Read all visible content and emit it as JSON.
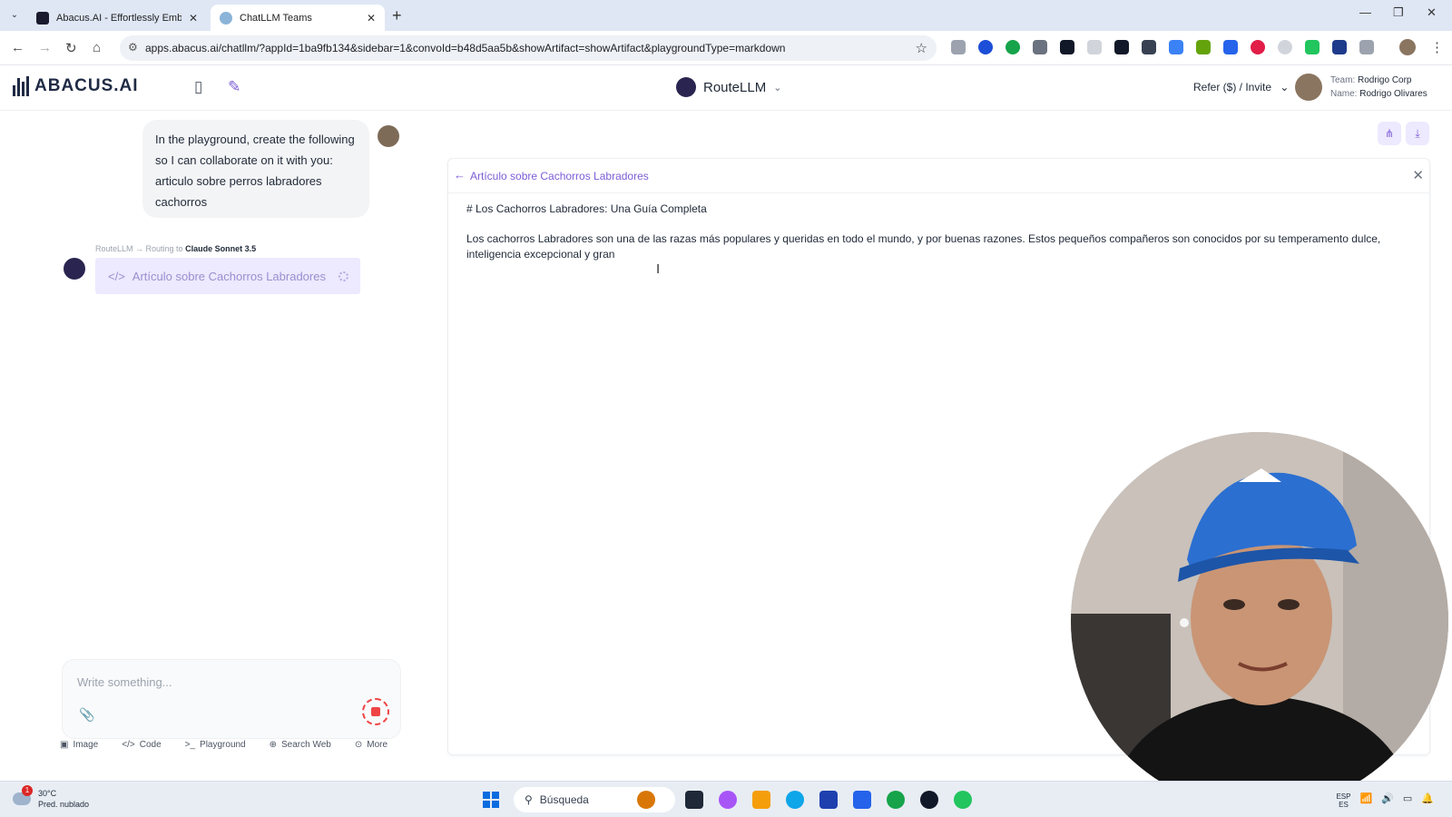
{
  "browser": {
    "tabs": [
      {
        "title": "Abacus.AI - Effortlessly Embed"
      },
      {
        "title": "ChatLLM Teams"
      }
    ],
    "url": "apps.abacus.ai/chatllm/?appId=1ba9fb134&sidebar=1&convoId=b48d5aa5b&showArtifact=showArtifact&playgroundType=markdown"
  },
  "app": {
    "logo": "ABACUS.AI",
    "model": "RouteLLM",
    "refer": "Refer ($) / Invite",
    "team_label": "Team:",
    "team": "Rodrigo Corp",
    "name_label": "Name:",
    "name": "Rodrigo Olivares"
  },
  "chat": {
    "user_message": "In the playground, create the following so I can collaborate on it with you: articulo sobre perros labradores cachorros",
    "routing_prefix": "RouteLLM → Routing to",
    "routing_model": "Claude Sonnet 3.5",
    "artifact_chip": "Artículo sobre Cachorros Labradores"
  },
  "composer": {
    "placeholder": "Write something...",
    "tools": [
      "Image",
      "Code",
      "Playground",
      "Search Web",
      "More"
    ]
  },
  "artifact": {
    "title": "Artículo sobre Cachorros Labradores",
    "heading": "# Los Cachorros Labradores: Una Guía Completa",
    "paragraph": "Los cachorros Labradores son una de las razas más populares y queridas en todo el mundo, y por buenas razones. Estos pequeños compañeros son conocidos por su temperamento dulce, inteligencia excepcional y gran"
  },
  "taskbar": {
    "weather_badge": "1",
    "temp": "30°C",
    "weather_desc": "Pred. nublado",
    "search_placeholder": "Búsqueda",
    "lang": "ESP",
    "lang2": "ES"
  },
  "colors": {
    "accent": "#7c5cd6",
    "accent_soft": "#ede9fe",
    "stop": "#ef4444"
  },
  "icons": [
    "chevron-down-icon",
    "close-icon",
    "plus-icon",
    "back-icon",
    "forward-icon",
    "reload-icon",
    "home-icon",
    "star-icon",
    "sidebar-toggle-icon",
    "edit-icon",
    "code-icon",
    "spinner-icon",
    "paperclip-icon",
    "stop-icon",
    "image-icon",
    "terminal-icon",
    "globe-icon",
    "more-icon",
    "share-icon",
    "download-icon",
    "search-icon",
    "windows-start-icon"
  ]
}
